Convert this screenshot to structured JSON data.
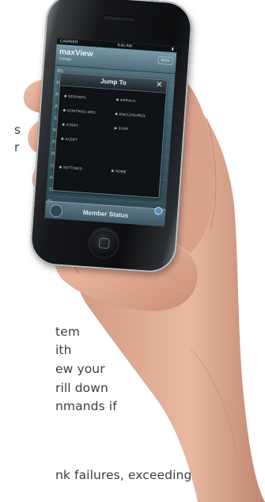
{
  "copy_lines": [
    "s",
    "r",
    "tem",
    "ith",
    "ew your",
    "rill down",
    "nmands if",
    "nk failures, exceeding"
  ],
  "phone": {
    "status_left": "CARRIER",
    "status_time": "9:41 AM",
    "app_logo": "maxView",
    "app_sub": "Storage",
    "app_right_button": "Back",
    "behind_rows": [
      "Ro",
      "Re",
      "Ra",
      "An",
      "Se",
      "Ne",
      "Pt",
      "Ru",
      "Ov",
      "Ac",
      "Su",
      "D"
    ],
    "dialog": {
      "title": "Jump To",
      "close": "✕",
      "items": [
        "SERVERS",
        "ARRAYS",
        "CONTROLLERS",
        "ENCLOSURES",
        "START",
        "STOP",
        "ALERT",
        "SETTINGS",
        "HOME"
      ]
    },
    "member_status": "Member Status"
  },
  "colors": {
    "skin": "#e3b09a",
    "skin_shadow": "#b67862",
    "phone_body": "#121417",
    "screen_teal": "#4b6b78"
  }
}
